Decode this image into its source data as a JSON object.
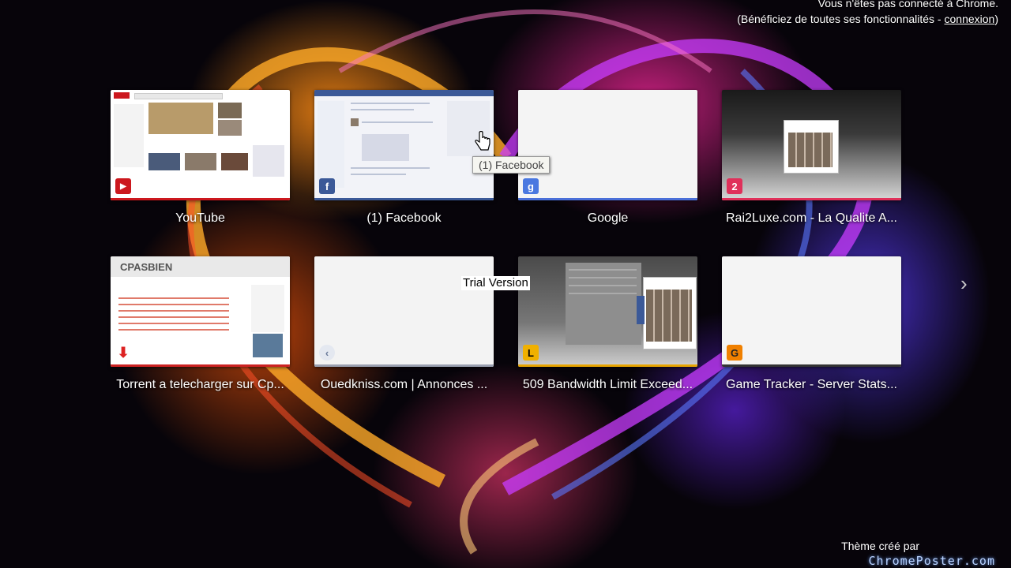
{
  "header": {
    "signin_line1": "Vous n'êtes pas connecté à Chrome.",
    "signin_line2_prefix": "(Bénéficiez de toutes ses fonctionnalités - ",
    "signin_link": "connexion",
    "signin_line2_suffix": ")"
  },
  "tiles": [
    {
      "title": "YouTube",
      "accent": "#cc181e",
      "icon": "youtube-icon"
    },
    {
      "title": "(1) Facebook",
      "accent": "#3b5998",
      "icon": "facebook-icon"
    },
    {
      "title": "Google",
      "accent": "#4a6fd8",
      "icon": "google-icon"
    },
    {
      "title": "Rai2Luxe.com - La Qualite A...",
      "accent": "#e0305a",
      "icon": "rai2luxe-icon"
    },
    {
      "title": "Torrent a telecharger sur Cp...",
      "accent": "#cc2222",
      "icon": "cpasbien-icon"
    },
    {
      "title": "Ouedkniss.com | Annonces ...",
      "accent": "#9aa0b0",
      "icon": "ouedkniss-icon"
    },
    {
      "title": "509 Bandwidth Limit Exceed...",
      "accent": "#e7a400",
      "icon": "bandwidth-icon"
    },
    {
      "title": "Game Tracker - Server Stats...",
      "accent": "#333333",
      "icon": "gametracker-icon"
    }
  ],
  "thumb_text": {
    "cpasbien_logo": "CPASBIEN"
  },
  "tooltip": "(1) Facebook",
  "watermark": "Trial Version",
  "footer": {
    "theme_by": "Thème créé par",
    "site": "ChromePoster.com"
  }
}
